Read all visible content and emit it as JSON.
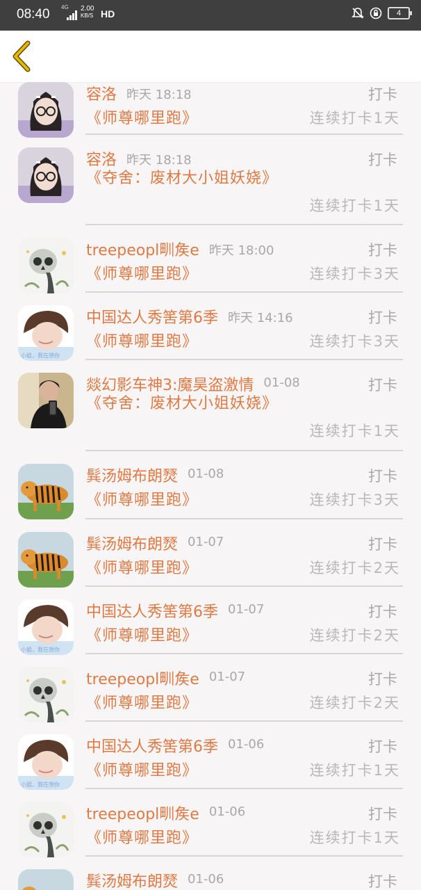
{
  "status_bar": {
    "time": "08:40",
    "net_label": "4G",
    "speed": "2.00",
    "speed_unit": "KB/S",
    "hd": "HD",
    "battery": "4"
  },
  "header": {
    "back_icon": "chevron-left-icon",
    "accent": "#e6b800"
  },
  "records": [
    {
      "name": "容洛",
      "time": "昨天 18:18",
      "action": "打卡",
      "title": "《师尊哪里跑》",
      "streak": "连续打卡1天",
      "avatar": "girl"
    },
    {
      "name": "容洛",
      "time": "昨天 18:18",
      "action": "打卡",
      "title": "《夺舍：废材大小姐妖娆》",
      "streak": "连续打卡1天",
      "avatar": "girl"
    },
    {
      "name": "treepeopl甽矦e",
      "time": "昨天 18:00",
      "action": "打卡",
      "title": "《师尊哪里跑》",
      "streak": "连续打卡3天",
      "avatar": "skull"
    },
    {
      "name": "中国达人秀筈第6季",
      "time": "昨天 14:16",
      "action": "打卡",
      "title": "《师尊哪里跑》",
      "streak": "连续打卡3天",
      "avatar": "person"
    },
    {
      "name": "燚幻影车神3:魔昊盗激情",
      "time": "01-08",
      "action": "打卡",
      "title": "《夺舍：废材大小姐妖娆》",
      "streak": "连续打卡1天",
      "avatar": "man"
    },
    {
      "name": "髸汤姆布朗燹",
      "time": "01-08",
      "action": "打卡",
      "title": "《师尊哪里跑》",
      "streak": "连续打卡3天",
      "avatar": "tiger"
    },
    {
      "name": "髸汤姆布朗燹",
      "time": "01-07",
      "action": "打卡",
      "title": "《师尊哪里跑》",
      "streak": "连续打卡2天",
      "avatar": "tiger"
    },
    {
      "name": "中国达人秀筈第6季",
      "time": "01-07",
      "action": "打卡",
      "title": "《师尊哪里跑》",
      "streak": "连续打卡2天",
      "avatar": "person"
    },
    {
      "name": "treepeopl甽矦e",
      "time": "01-07",
      "action": "打卡",
      "title": "《师尊哪里跑》",
      "streak": "连续打卡2天",
      "avatar": "skull"
    },
    {
      "name": "中国达人秀筈第6季",
      "time": "01-06",
      "action": "打卡",
      "title": "《师尊哪里跑》",
      "streak": "连续打卡1天",
      "avatar": "person"
    },
    {
      "name": "treepeopl甽矦e",
      "time": "01-06",
      "action": "打卡",
      "title": "《师尊哪里跑》",
      "streak": "连续打卡1天",
      "avatar": "skull"
    },
    {
      "name": "髸汤姆布朗燹",
      "time": "01-06",
      "action": "打卡",
      "title": "",
      "streak": "",
      "avatar": "tiger"
    }
  ],
  "avatar_overlay_text": "小姐，我在想你",
  "colors": {
    "name": "#e07a45",
    "meta": "#a8a8a8",
    "separator": "#d6d6d6",
    "status_bar": "#3f3f3f"
  }
}
